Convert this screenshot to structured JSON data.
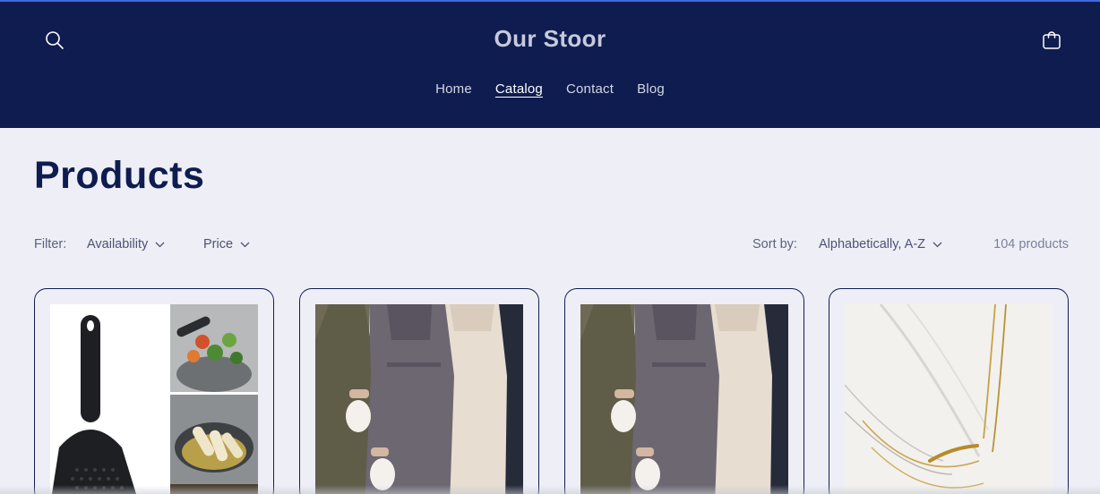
{
  "header": {
    "logo": "Our Stoor",
    "nav": [
      {
        "label": "Home",
        "active": false
      },
      {
        "label": "Catalog",
        "active": true
      },
      {
        "label": "Contact",
        "active": false
      },
      {
        "label": "Blog",
        "active": false
      }
    ],
    "search_icon": "search-icon",
    "cart_icon": "shopping-bag-icon"
  },
  "main": {
    "title": "Products",
    "filter": {
      "label": "Filter:",
      "availability": "Availability",
      "price": "Price"
    },
    "sort": {
      "label": "Sort by:",
      "value": "Alphabetically, A-Z"
    },
    "product_count": "104 products"
  },
  "colors": {
    "header_bg": "#0f1c50",
    "accent_line": "#4169e1",
    "page_bg": "#eeeff6",
    "title": "#0f1c50"
  }
}
